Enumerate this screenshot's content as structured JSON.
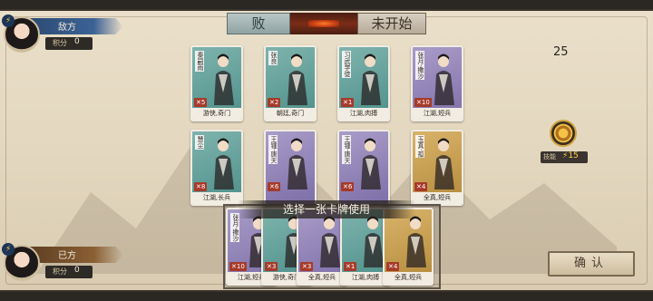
{
  "header": {
    "status_left": "败",
    "status_right": "未开始"
  },
  "enemy": {
    "name": "敌方",
    "score_label": "积分",
    "score": "0"
  },
  "self": {
    "name": "已方",
    "score_label": "积分",
    "score": "0"
  },
  "turn_counter": "25",
  "skill": {
    "label": "技能",
    "value": "15"
  },
  "board_cards": [
    {
      "name": "秦嗣雨",
      "cost": "5",
      "tags": "游侠,奇门",
      "color": "teal"
    },
    {
      "name": "张良",
      "cost": "2",
      "tags": "朝廷,奇门",
      "color": "teal"
    },
    {
      "name": "习武学徒",
      "cost": "1",
      "tags": "江湖,肉搏",
      "color": "teal"
    },
    {
      "name": "张月·撒沙",
      "cost": "10",
      "tags": "江湖,短兵",
      "color": "violet"
    },
    {
      "name": "慧尘",
      "cost": "8",
      "tags": "江湖,长兵",
      "color": "teal"
    },
    {
      "name": "王锺·唐天",
      "cost": "6",
      "tags": "",
      "color": "violet"
    },
    {
      "name": "王锺·唐天",
      "cost": "6",
      "tags": "",
      "color": "violet"
    },
    {
      "name": "玉真·孤",
      "cost": "4",
      "tags": "全真,短兵",
      "color": "gold"
    }
  ],
  "prompt": "选择一张卡牌使用",
  "hand_cards": [
    {
      "name": "张月·撒沙",
      "cost": "10",
      "tags": "江湖,短兵",
      "color": "violet"
    },
    {
      "name": "",
      "cost": "3",
      "tags": "游侠,奇门",
      "color": "teal"
    },
    {
      "name": "",
      "cost": "3",
      "tags": "全真,短兵",
      "color": "violet"
    },
    {
      "name": "",
      "cost": "1",
      "tags": "江湖,肉搏",
      "color": "teal"
    },
    {
      "name": "",
      "cost": "4",
      "tags": "全真,短兵",
      "color": "gold"
    }
  ],
  "confirm_label": "确认",
  "colors": {
    "teal": "#5f9f99",
    "violet": "#8e80b6",
    "gold": "#c59c4e",
    "cost_badge": "#a63a2a"
  }
}
